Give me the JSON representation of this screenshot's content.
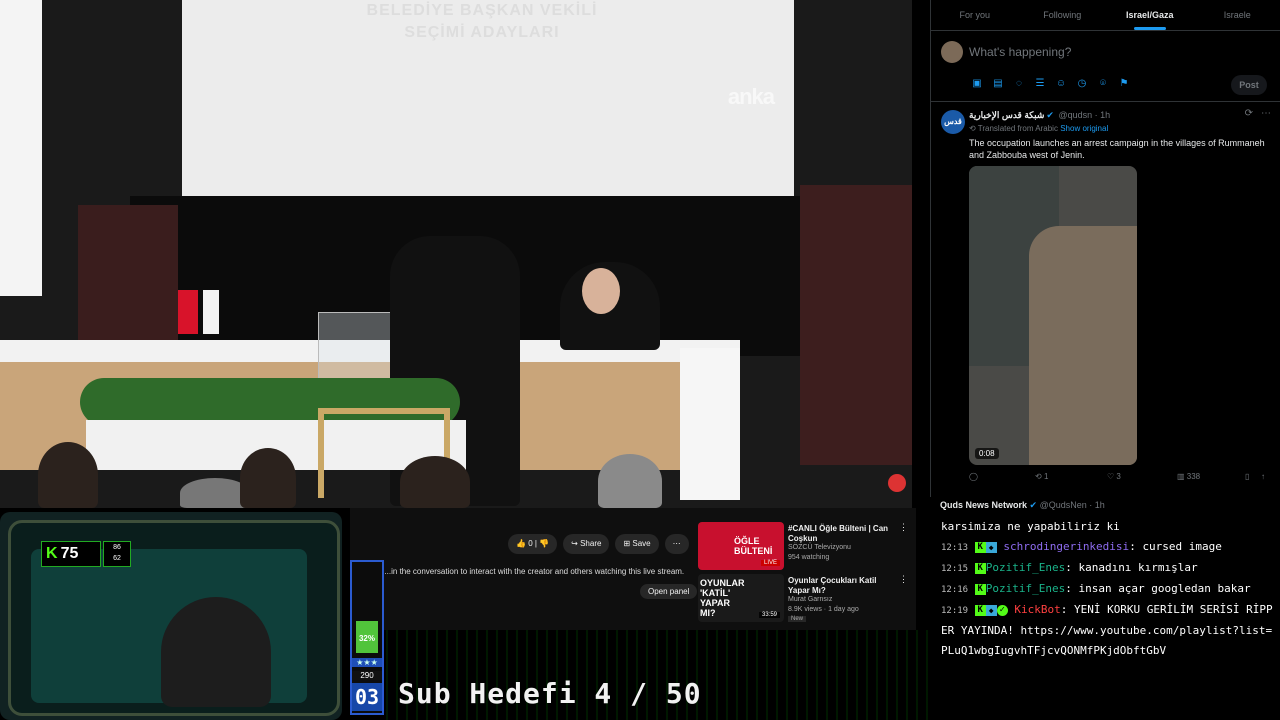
{
  "video": {
    "screen_title": "BELEDİYE BAŞKAN VEKİLİ SEÇİMİ ADAYLARI",
    "watermark": "anka"
  },
  "x_panel": {
    "tabs": [
      {
        "label": "For you",
        "active": false
      },
      {
        "label": "Following",
        "active": false
      },
      {
        "label": "Israel/Gaza",
        "active": true
      },
      {
        "label": "Israele",
        "active": false
      }
    ],
    "compose_placeholder": "What's happening?",
    "post_label": "Post",
    "tweet": {
      "author": "شبكة قدس الإخبارية",
      "handle": "@qudsn",
      "time": "1h",
      "translated": "Translated from Arabic",
      "show_original": "Show original",
      "text": "The occupation launches an arrest campaign in the villages of Rummaneh and Zabbouba west of Jenin.",
      "duration": "0:08",
      "retweets": "1",
      "likes": "3",
      "views": "338"
    }
  },
  "chat": {
    "next_author": "Quds News Network",
    "next_handle": "@QudsNen",
    "next_time": "1h",
    "messages": [
      {
        "time": "",
        "user": "",
        "text": "karsimiza ne yapabiliriz ki"
      },
      {
        "time": "12:13",
        "user": "schrodingerinkedisi",
        "text": "cursed image"
      },
      {
        "time": "12:15",
        "user": "Pozitif_Enes",
        "text": "kanadını kırmışlar"
      },
      {
        "time": "12:16",
        "user": "Pozitif_Enes",
        "text": "insan açar googledan bakar"
      },
      {
        "time": "12:19",
        "user": "KickBot",
        "text": "YENİ KORKU GERİLİM SERİSİ RİPPER YAYINDA! https://www.youtube.com/playlist?list=PLuQ1wbgIugvhTFjcvQONMfPKjdObftGbV"
      }
    ]
  },
  "youtube": {
    "like_count": "0",
    "share_label": "Share",
    "save_label": "Save",
    "chat_text": "t  ...in the conversation to interact with the creator and others watching this live stream.",
    "open_panel": "Open panel",
    "recs": [
      {
        "title": "#CANLI Öğle Bülteni | Can Coşkun",
        "channel": "SÖZCÜ Televizyonu",
        "views": "954 watching",
        "thumb_label": "ÖĞLE BÜLTENİ",
        "badge": "LIVE"
      },
      {
        "title": "Oyunlar Çocukları Katil Yapar Mı?",
        "channel": "Murat Garnsız",
        "views": "8.9K views · 1 day ago",
        "thumb_label": "OYUNLAR 'KATİL' YAPAR MI?",
        "badge": "33:59",
        "tag": "New"
      }
    ]
  },
  "overlay": {
    "kick_level": "75",
    "stat_top": "86",
    "stat_bottom": "62",
    "meter_pct": "32%",
    "meter_fill_fraction": 0.32,
    "meter_count": "290",
    "meter_level": "03",
    "sub_goal": "Sub Hedefi 4 / 50"
  },
  "colors": {
    "accent": "#1d9bf0",
    "kick_green": "#53fc18"
  }
}
